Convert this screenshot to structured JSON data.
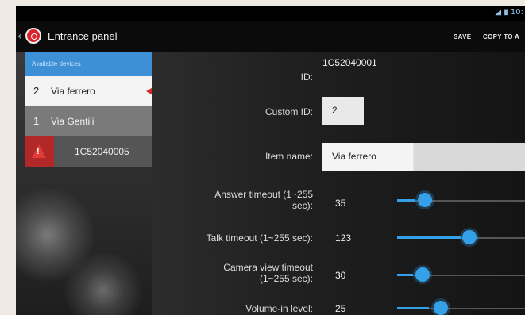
{
  "status": {
    "time_partial": "10:"
  },
  "actionbar": {
    "title": "Entrance panel",
    "save_label": "SAVE",
    "copy_label": "COPY TO A"
  },
  "devices": {
    "header": "Available devices",
    "items": [
      {
        "number": "2",
        "name": "Via ferrero",
        "selected": true
      },
      {
        "number": "1",
        "name": "Via Gentili"
      },
      {
        "name": "1C52040005",
        "warning": true
      }
    ]
  },
  "form": {
    "id_label": "ID:",
    "id_value": "1C52040001",
    "custom_id_label": "Custom ID:",
    "custom_id_value": "2",
    "item_name_label": "Item name:",
    "item_name_value": "Via ferrero",
    "answer_timeout_label": "Answer timeout (1~255 sec):",
    "answer_timeout_value": "35",
    "talk_timeout_label": "Talk timeout (1~255 sec):",
    "talk_timeout_value": "123",
    "camera_timeout_label": "Camera view timeout (1~255 sec):",
    "camera_timeout_value": "30",
    "volume_label": "Volume-in level:",
    "volume_value": "25"
  },
  "colors": {
    "accent": "#33a0e8",
    "alert": "#d42a2a"
  }
}
